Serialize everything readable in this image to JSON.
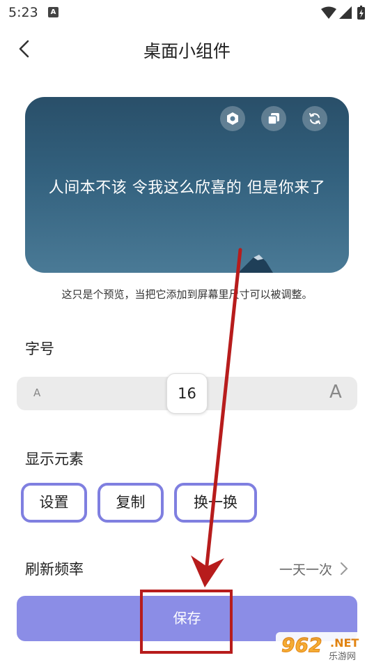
{
  "status_bar": {
    "time": "5:23",
    "notification_icon": "A"
  },
  "header": {
    "title": "桌面小组件",
    "back_icon": "chevron-left-icon"
  },
  "preview": {
    "quote": "人间本不该 令我这么欣喜的 但是你来了",
    "note": "这只是个预览，当把它添加到屏幕里尺寸可以被调整。",
    "icons": [
      "settings-hexagon-icon",
      "copy-icon",
      "refresh-icon"
    ],
    "background_color": "#33617e"
  },
  "font_size": {
    "label": "字号",
    "small_marker": "A",
    "large_marker": "A",
    "value": "16"
  },
  "elements": {
    "label": "显示元素",
    "chips": [
      "设置",
      "复制",
      "换一换"
    ],
    "chip_border_color": "#7f7fe0"
  },
  "refresh": {
    "label": "刷新频率",
    "value": "一天一次"
  },
  "save_button": {
    "label": "保存",
    "color": "#8b8de6"
  },
  "watermark": {
    "logo": "962",
    "domain": ".NET",
    "name": "乐游网"
  },
  "annotation_color": "#b71c1c"
}
